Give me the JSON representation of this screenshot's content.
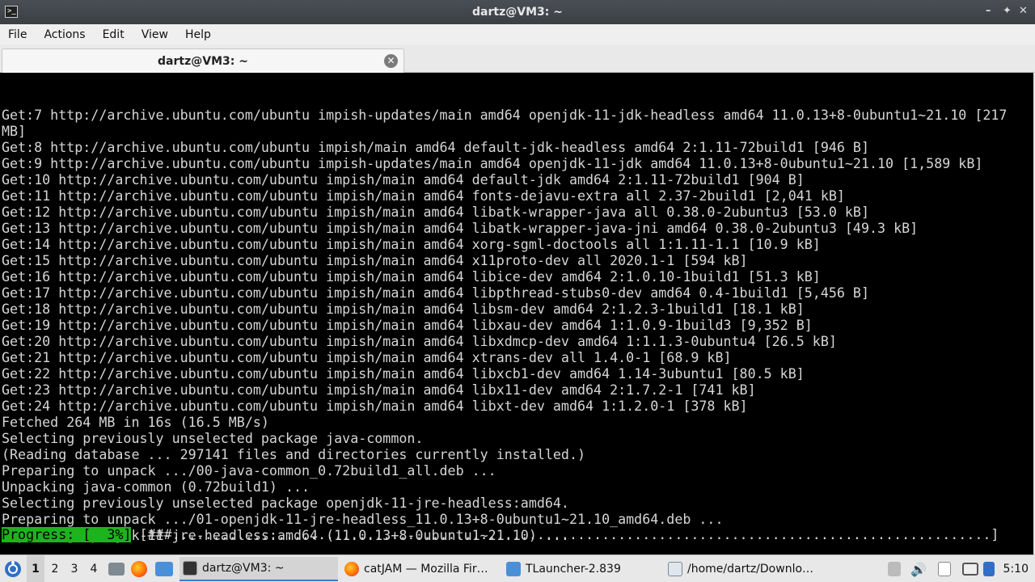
{
  "window": {
    "title": "dartz@VM3: ~",
    "controls": [
      "–",
      "✦",
      "✕"
    ]
  },
  "menu": [
    "File",
    "Actions",
    "Edit",
    "View",
    "Help"
  ],
  "tab": {
    "label": "dartz@VM3: ~",
    "close": "✕"
  },
  "terminal": {
    "lines": [
      "Get:7 http://archive.ubuntu.com/ubuntu impish-updates/main amd64 openjdk-11-jdk-headless amd64 11.0.13+8-0ubuntu1~21.10 [217",
      "MB]",
      "Get:8 http://archive.ubuntu.com/ubuntu impish/main amd64 default-jdk-headless amd64 2:1.11-72build1 [946 B]",
      "Get:9 http://archive.ubuntu.com/ubuntu impish-updates/main amd64 openjdk-11-jdk amd64 11.0.13+8-0ubuntu1~21.10 [1,589 kB]",
      "Get:10 http://archive.ubuntu.com/ubuntu impish/main amd64 default-jdk amd64 2:1.11-72build1 [904 B]",
      "Get:11 http://archive.ubuntu.com/ubuntu impish/main amd64 fonts-dejavu-extra all 2.37-2build1 [2,041 kB]",
      "Get:12 http://archive.ubuntu.com/ubuntu impish/main amd64 libatk-wrapper-java all 0.38.0-2ubuntu3 [53.0 kB]",
      "Get:13 http://archive.ubuntu.com/ubuntu impish/main amd64 libatk-wrapper-java-jni amd64 0.38.0-2ubuntu3 [49.3 kB]",
      "Get:14 http://archive.ubuntu.com/ubuntu impish/main amd64 xorg-sgml-doctools all 1:1.11-1.1 [10.9 kB]",
      "Get:15 http://archive.ubuntu.com/ubuntu impish/main amd64 x11proto-dev all 2020.1-1 [594 kB]",
      "Get:16 http://archive.ubuntu.com/ubuntu impish/main amd64 libice-dev amd64 2:1.0.10-1build1 [51.3 kB]",
      "Get:17 http://archive.ubuntu.com/ubuntu impish/main amd64 libpthread-stubs0-dev amd64 0.4-1build1 [5,456 B]",
      "Get:18 http://archive.ubuntu.com/ubuntu impish/main amd64 libsm-dev amd64 2:1.2.3-1build1 [18.1 kB]",
      "Get:19 http://archive.ubuntu.com/ubuntu impish/main amd64 libxau-dev amd64 1:1.0.9-1build3 [9,352 B]",
      "Get:20 http://archive.ubuntu.com/ubuntu impish/main amd64 libxdmcp-dev amd64 1:1.1.3-0ubuntu4 [26.5 kB]",
      "Get:21 http://archive.ubuntu.com/ubuntu impish/main amd64 xtrans-dev all 1.4.0-1 [68.9 kB]",
      "Get:22 http://archive.ubuntu.com/ubuntu impish/main amd64 libxcb1-dev amd64 1.14-3ubuntu1 [80.5 kB]",
      "Get:23 http://archive.ubuntu.com/ubuntu impish/main amd64 libx11-dev amd64 2:1.7.2-1 [741 kB]",
      "Get:24 http://archive.ubuntu.com/ubuntu impish/main amd64 libxt-dev amd64 1:1.2.0-1 [378 kB]",
      "Fetched 264 MB in 16s (16.5 MB/s)",
      "Selecting previously unselected package java-common.",
      "(Reading database ... 297141 files and directories currently installed.)",
      "Preparing to unpack .../00-java-common_0.72build1_all.deb ...",
      "Unpacking java-common (0.72build1) ...",
      "Selecting previously unselected package openjdk-11-jre-headless:amd64.",
      "Preparing to unpack .../01-openjdk-11-jre-headless_11.0.13+8-0ubuntu1~21.10_amd64.deb ...",
      "Unpacking openjdk-11-jre-headless:amd64 (11.0.13+8-0ubuntu1~21.10) ..."
    ],
    "progress_label": "Progress: [  3%]",
    "progress_bar": " [###.....................................................................................................]",
    "progress_fraction": 0.03
  },
  "taskbar": {
    "workspaces": [
      "1",
      "2",
      "3",
      "4"
    ],
    "active_workspace": "1",
    "tasks": [
      {
        "label": "dartz@VM3: ~",
        "icon": "terminal-icon"
      },
      {
        "label": "catJAM — Mozilla Fir…",
        "icon": "firefox-icon"
      },
      {
        "label": "TLauncher-2.839",
        "icon": "folder-icon"
      },
      {
        "label": "/home/dartz/Downlo…",
        "icon": "text-editor-icon"
      }
    ],
    "clock": "5:10",
    "colors": {
      "active_underline": "#3a7bd5",
      "progress_green": "#1db31d"
    }
  }
}
